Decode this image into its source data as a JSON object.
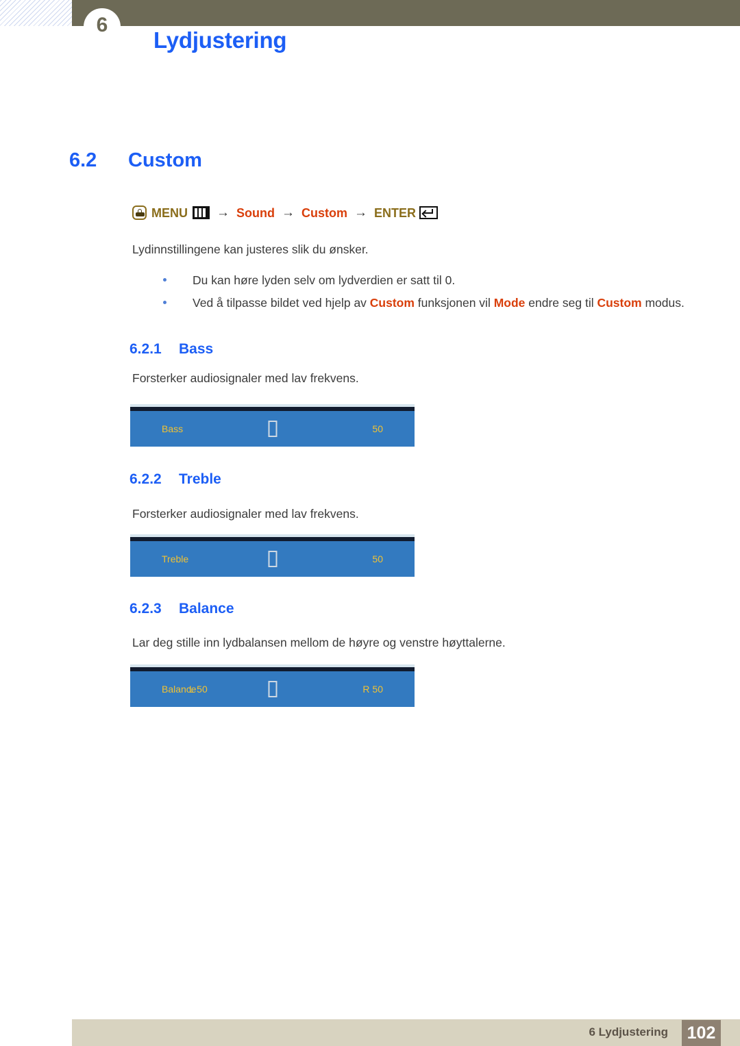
{
  "header": {
    "chapter_number": "6",
    "title": "Lydjustering",
    "band_color": "#6d6a56",
    "title_color": "#1c5ef5"
  },
  "section": {
    "number": "6.2",
    "title": "Custom"
  },
  "menu_path": {
    "hand_icon": "hand-pointer-icon",
    "menu_label": "MENU",
    "menu_icon": "menu-bars-icon",
    "arrow_1": "→",
    "item_sound": "Sound",
    "arrow_2": "→",
    "item_custom": "Custom",
    "arrow_3": "→",
    "enter_label": "ENTER",
    "enter_icon": "enter-key-icon",
    "gold_color": "#8a6d1b",
    "red_color": "#d93f0b"
  },
  "intro": {
    "paragraph": "Lydinnstillingene kan justeres slik du ønsker."
  },
  "bullets": [
    {
      "parts": [
        {
          "text": "Du kan høre lyden selv om lydverdien er satt til 0.",
          "highlight": false
        }
      ]
    },
    {
      "parts": [
        {
          "text": "Ved å tilpasse bildet ved hjelp av ",
          "highlight": false
        },
        {
          "text": "Custom",
          "highlight": true
        },
        {
          "text": " funksjonen vil ",
          "highlight": false
        },
        {
          "text": "Mode",
          "highlight": true
        },
        {
          "text": " endre seg til ",
          "highlight": false
        },
        {
          "text": "Custom",
          "highlight": true
        },
        {
          "text": " modus.",
          "highlight": false
        }
      ]
    }
  ],
  "subsections": [
    {
      "number": "6.2.1",
      "title": "Bass",
      "description": "Forsterker audiosignaler med lav frekvens.",
      "osd": {
        "label": "Bass",
        "sublabel": "",
        "center_glyph": "□",
        "value": "50"
      }
    },
    {
      "number": "6.2.2",
      "title": "Treble",
      "description": "Forsterker audiosignaler med lav frekvens.",
      "osd": {
        "label": "Treble",
        "sublabel": "",
        "center_glyph": "□",
        "value": "50"
      }
    },
    {
      "number": "6.2.3",
      "title": "Balance",
      "description": "Lar deg stille inn lydbalansen mellom de høyre og venstre høyttalerne.",
      "osd": {
        "label": "Balance",
        "sublabel": "L 50",
        "center_glyph": "□",
        "value": "R 50"
      }
    }
  ],
  "osd_colors": {
    "body": "#337ac0",
    "dark_bar": "#111b2e",
    "top_line": "#d7e6ef",
    "text": "#f1c232"
  },
  "footer": {
    "text": "6 Lydjustering",
    "page_number": "102",
    "bar_color": "#d8d3c0",
    "page_box_color": "#8e8172"
  }
}
